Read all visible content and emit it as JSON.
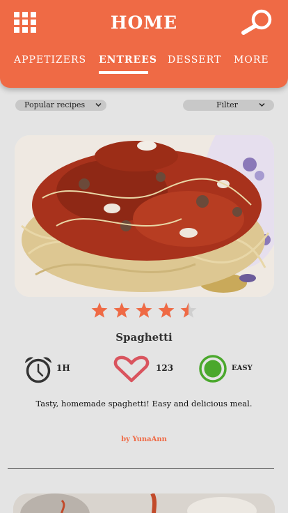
{
  "header": {
    "title": "HOME",
    "menu_icon": "grid-icon",
    "search_icon": "search-icon"
  },
  "tabs": [
    {
      "label": "APPETIZERS",
      "active": false
    },
    {
      "label": "ENTREES",
      "active": true
    },
    {
      "label": "DESSERT",
      "active": false
    },
    {
      "label": "MORE",
      "active": false
    }
  ],
  "filters": {
    "sort": {
      "label": "Popular recipes"
    },
    "filter": {
      "label": "Filter"
    }
  },
  "recipe": {
    "name": "Spaghetti",
    "rating": 4.5,
    "rating_max": 5,
    "time": "1H",
    "likes": "123",
    "difficulty": "EASY",
    "description": "Tasty, homemade spaghetti! Easy and delicious meal.",
    "author": "by YunaAnn"
  },
  "colors": {
    "accent": "#ef6a45",
    "heart": "#d9545e",
    "easy": "#4aa82c",
    "background": "#e4e4e4"
  }
}
